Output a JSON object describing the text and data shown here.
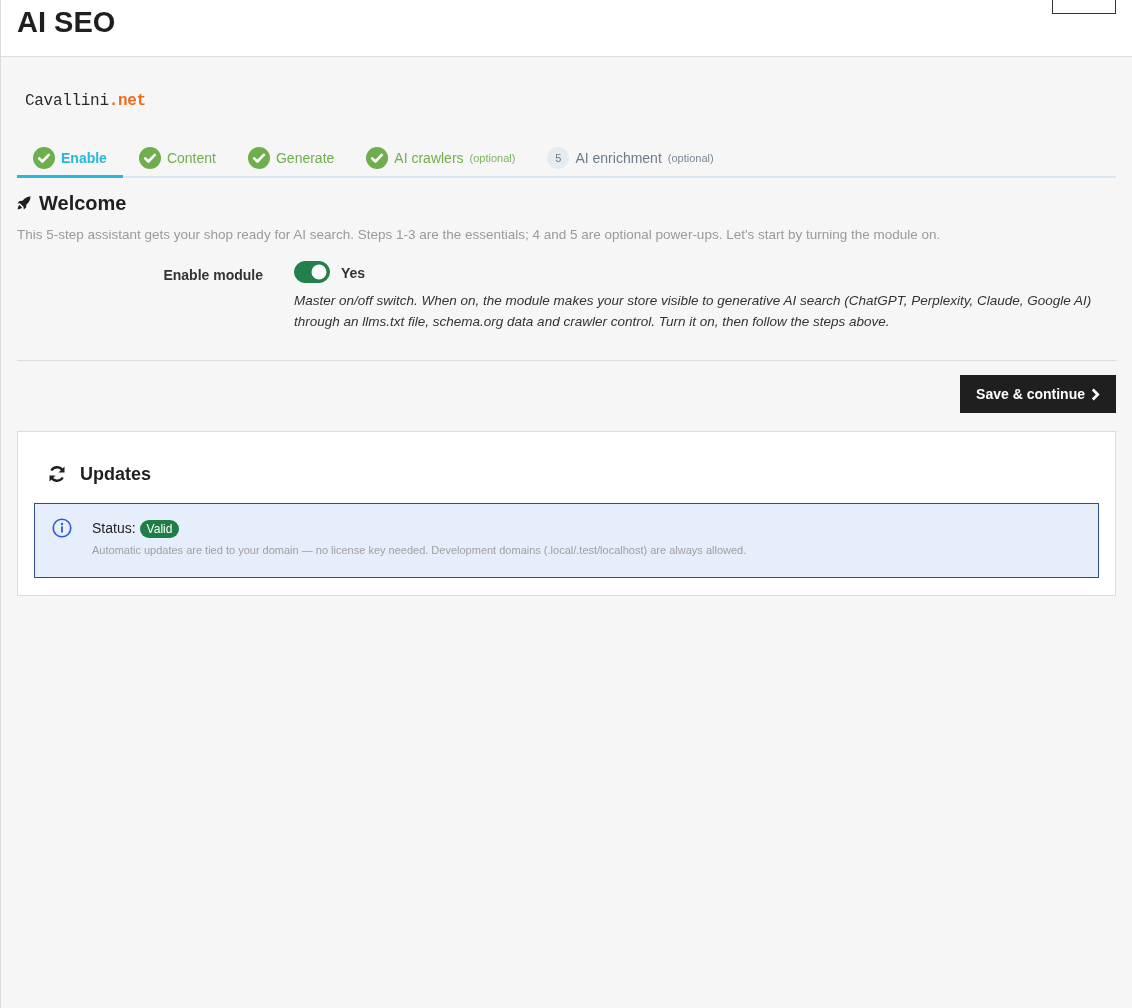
{
  "header": {
    "title": "AI SEO"
  },
  "logo": {
    "name": "Cavallini",
    "suffix": ".net"
  },
  "steps": [
    {
      "label": "Enable",
      "done": true,
      "selected": true
    },
    {
      "label": "Content",
      "done": true,
      "selected": false
    },
    {
      "label": "Generate",
      "done": true,
      "selected": false
    },
    {
      "label": "AI crawlers",
      "note": "(optional)",
      "done": true,
      "selected": false
    },
    {
      "label": "AI enrichment",
      "note": "(optional)",
      "number": "5",
      "done": false,
      "selected": false
    }
  ],
  "welcome": {
    "title": "Welcome",
    "description": "This 5-step assistant gets your shop ready for AI search. Steps 1-3 are the essentials; 4 and 5 are optional power-ups. Let's start by turning the module on."
  },
  "fields": [
    {
      "kind": "switch",
      "label": "Enable module",
      "on": true,
      "value_label": "Yes",
      "help": "Master on/off switch. When on, the module makes your store visible to generative AI search (ChatGPT, Perplexity, Claude, Google AI) through an llms.txt file, schema.org data and crawler control. Turn it on, then follow the steps above."
    }
  ],
  "actions": {
    "save": "Save & continue"
  },
  "updates": {
    "title": "Updates",
    "alert": {
      "status_label": "Status:",
      "badge": "Valid",
      "text": "Automatic updates are tied to your domain — no license key needed. Development domains (.local/.test/localhost) are always allowed."
    }
  }
}
